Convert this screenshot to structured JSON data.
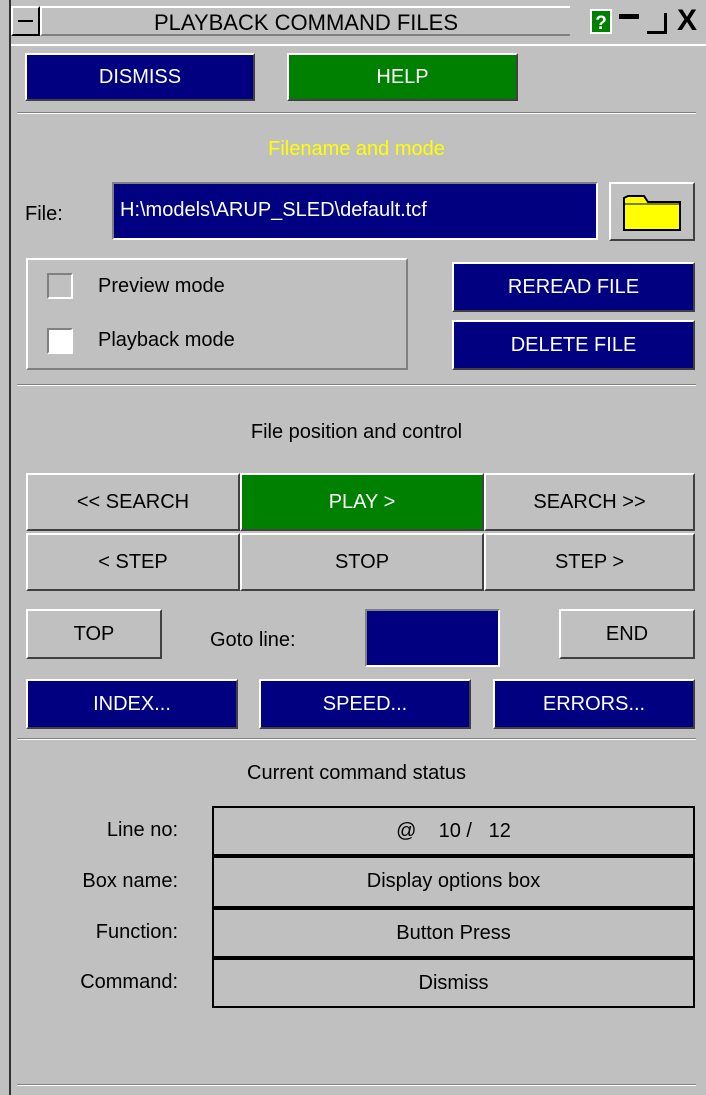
{
  "window": {
    "title": "PLAYBACK COMMAND FILES",
    "help_glyph": "?",
    "close_glyph": "X",
    "icons": [
      "system-menu-icon",
      "help-icon",
      "minimize-icon",
      "maximize-icon",
      "close-icon"
    ]
  },
  "top_buttons": {
    "dismiss": "DISMISS",
    "help": "HELP"
  },
  "filename_section": {
    "heading": "Filename and mode",
    "heading_color": "#ffff00",
    "file_label": "File:",
    "file_value": "H:\\models\\ARUP_SLED\\default.tcf",
    "folder_icon": "folder-icon",
    "modes": [
      {
        "label": "Preview mode",
        "checked": false
      },
      {
        "label": "Playback mode",
        "checked": false
      }
    ],
    "reread": "REREAD FILE",
    "delete": "DELETE FILE"
  },
  "control_section": {
    "heading": "File position and control",
    "search_back": "<< SEARCH",
    "play": "PLAY  >",
    "search_fwd": "SEARCH  >>",
    "step_back": "<  STEP",
    "stop": "STOP",
    "step_fwd": "STEP  >",
    "top": "TOP",
    "goto_label": "Goto line:",
    "goto_value": "",
    "end": "END",
    "index": "INDEX...",
    "speed": "SPEED...",
    "errors": "ERRORS..."
  },
  "status_section": {
    "heading": "Current command status",
    "rows": [
      {
        "label": "Line no:",
        "value": "@    10 /   12"
      },
      {
        "label": "Box name:",
        "value": "Display options box"
      },
      {
        "label": "Function:",
        "value": "Button Press"
      },
      {
        "label": "Command:",
        "value": "Dismiss"
      }
    ]
  },
  "colors": {
    "panel": "#c0c0c0",
    "blue_button": "#000080",
    "green_button": "#008000",
    "heading_yellow": "#ffff00",
    "folder_yellow": "#ffff00"
  }
}
